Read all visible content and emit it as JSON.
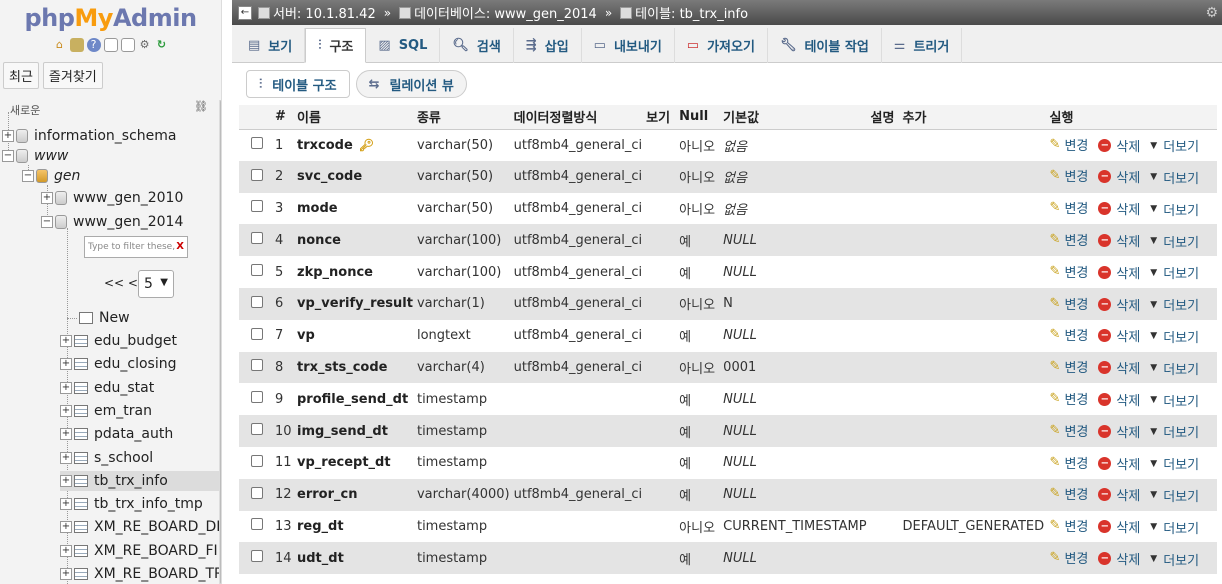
{
  "nav": {
    "logo_php": "php",
    "logo_my": "My",
    "logo_admin": "Admin",
    "tab_recent": "최근",
    "tab_favorites": "즐겨찾기",
    "partial_top": "새로운",
    "items": [
      {
        "label": "information_schema"
      },
      {
        "label": "www"
      },
      {
        "label": "gen"
      },
      {
        "label": "www_gen_2010"
      },
      {
        "label": "www_gen_2014"
      }
    ],
    "filter_placeholder": "Type to filter these,",
    "filter_clear": "X",
    "pager_prev": "<<  <",
    "pager_value": "5",
    "new_label": "New",
    "tables": [
      "edu_budget",
      "edu_closing",
      "edu_stat",
      "em_tran",
      "pdata_auth",
      "s_school",
      "tb_trx_info",
      "tb_trx_info_tmp",
      "XM_RE_BOARD_DIV",
      "XM_RE_BOARD_FIL",
      "XM_RE_BOARD_TRA"
    ]
  },
  "breadcrumb": {
    "server": "서버: 10.1.81.42",
    "database": "데이터베이스: www_gen_2014",
    "table": "테이블: tb_trx_info"
  },
  "tabs": [
    "보기",
    "구조",
    "SQL",
    "검색",
    "삽입",
    "내보내기",
    "가져오기",
    "테이블 작업",
    "트리거"
  ],
  "subtabs": [
    "테이블 구조",
    "릴레이션 뷰"
  ],
  "columns": [
    "",
    "#",
    "이름",
    "종류",
    "데이터정렬방식",
    "보기",
    "Null",
    "기본값",
    "설명",
    "추가",
    "실행"
  ],
  "actions": {
    "edit": "변경",
    "delete": "삭제",
    "more": "더보기"
  },
  "rows": [
    {
      "n": "1",
      "name": "trxcode",
      "type": "varchar(50)",
      "coll": "utf8mb4_general_ci",
      "null": "아니오",
      "def": "없음",
      "extra": "",
      "key": true
    },
    {
      "n": "2",
      "name": "svc_code",
      "type": "varchar(50)",
      "coll": "utf8mb4_general_ci",
      "null": "아니오",
      "def": "없음",
      "extra": ""
    },
    {
      "n": "3",
      "name": "mode",
      "type": "varchar(50)",
      "coll": "utf8mb4_general_ci",
      "null": "아니오",
      "def": "없음",
      "extra": ""
    },
    {
      "n": "4",
      "name": "nonce",
      "type": "varchar(100)",
      "coll": "utf8mb4_general_ci",
      "null": "예",
      "def": "NULL",
      "extra": ""
    },
    {
      "n": "5",
      "name": "zkp_nonce",
      "type": "varchar(100)",
      "coll": "utf8mb4_general_ci",
      "null": "예",
      "def": "NULL",
      "extra": ""
    },
    {
      "n": "6",
      "name": "vp_verify_result",
      "type": "varchar(1)",
      "coll": "utf8mb4_general_ci",
      "null": "아니오",
      "def": "N",
      "extra": ""
    },
    {
      "n": "7",
      "name": "vp",
      "type": "longtext",
      "coll": "utf8mb4_general_ci",
      "null": "예",
      "def": "NULL",
      "extra": ""
    },
    {
      "n": "8",
      "name": "trx_sts_code",
      "type": "varchar(4)",
      "coll": "utf8mb4_general_ci",
      "null": "아니오",
      "def": "0001",
      "extra": ""
    },
    {
      "n": "9",
      "name": "profile_send_dt",
      "type": "timestamp",
      "coll": "",
      "null": "예",
      "def": "NULL",
      "extra": ""
    },
    {
      "n": "10",
      "name": "img_send_dt",
      "type": "timestamp",
      "coll": "",
      "null": "예",
      "def": "NULL",
      "extra": ""
    },
    {
      "n": "11",
      "name": "vp_recept_dt",
      "type": "timestamp",
      "coll": "",
      "null": "예",
      "def": "NULL",
      "extra": ""
    },
    {
      "n": "12",
      "name": "error_cn",
      "type": "varchar(4000)",
      "coll": "utf8mb4_general_ci",
      "null": "예",
      "def": "NULL",
      "extra": ""
    },
    {
      "n": "13",
      "name": "reg_dt",
      "type": "timestamp",
      "coll": "",
      "null": "아니오",
      "def": "CURRENT_TIMESTAMP",
      "extra": "DEFAULT_GENERATED"
    },
    {
      "n": "14",
      "name": "udt_dt",
      "type": "timestamp",
      "coll": "",
      "null": "예",
      "def": "NULL",
      "extra": ""
    }
  ]
}
